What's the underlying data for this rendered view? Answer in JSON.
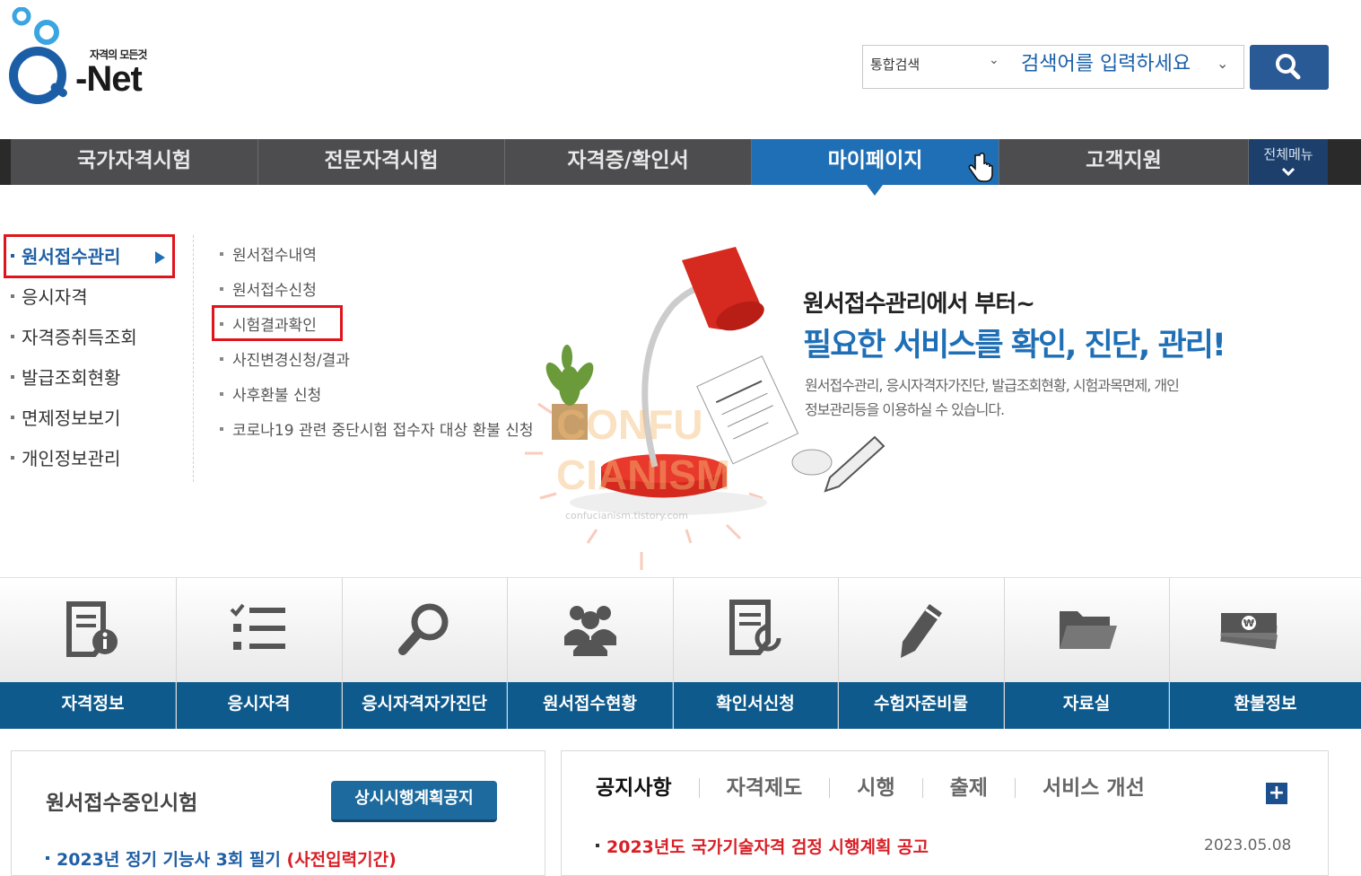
{
  "header": {
    "logo_tagline": "자격의 모든것",
    "logo_text": "-Net",
    "search_category": "통합검색",
    "search_placeholder": "검색어를 입력하세요"
  },
  "nav": {
    "items": [
      "국가자격시험",
      "전문자격시험",
      "자격증/확인서",
      "마이페이지",
      "고객지원"
    ],
    "active": "마이페이지",
    "all_menu_label": "전체메뉴"
  },
  "mypage_menu": {
    "left_items": [
      "원서접수관리",
      "응시자격",
      "자격증취득조회",
      "발급조회현황",
      "면제정보보기",
      "개인정보관리"
    ],
    "left_active": "원서접수관리",
    "sub_items": [
      "원서접수내역",
      "원서접수신청",
      "시험결과확인",
      "사진변경신청/결과",
      "사후환불 신청",
      "코로나19 관련 중단시험 접수자 대상 환불 신청"
    ],
    "sub_highlighted": "시험결과확인",
    "promo_line1": "원서접수관리에서 부터~",
    "promo_line2": "필요한 서비스를 확인, 진단, 관리!",
    "promo_desc": "원서접수관리, 응시자격자가진단, 발급조회현황, 시험과목면제, 개인정보관리등을 이용하실 수 있습니다.",
    "watermark_line1": "CONFU",
    "watermark_line2": "CIANISM",
    "watermark_url": "confucianism.tistory.com"
  },
  "quick_menu": [
    {
      "label": "자격정보",
      "icon": "document-info-icon"
    },
    {
      "label": "응시자격",
      "icon": "checklist-icon"
    },
    {
      "label": "응시자격자가진단",
      "icon": "magnifier-icon"
    },
    {
      "label": "원서접수현황",
      "icon": "people-icon"
    },
    {
      "label": "확인서신청",
      "icon": "document-return-icon"
    },
    {
      "label": "수험자준비물",
      "icon": "pencil-icon"
    },
    {
      "label": "자료실",
      "icon": "folder-icon"
    },
    {
      "label": "환불정보",
      "icon": "money-icon"
    }
  ],
  "exam_box": {
    "title": "원서접수중인시험",
    "button": "상시시행계획공지",
    "item_main": "2023년 정기 기능사 3회 필기",
    "item_note": "(사전입력기간)"
  },
  "notice_box": {
    "tabs": [
      "공지사항",
      "자격제도",
      "시행",
      "출제",
      "서비스 개선"
    ],
    "more_label": "+",
    "notice_title": "2023년도 국가기술자격 검정 시행계획 공고",
    "notice_date": "2023.05.08"
  },
  "colors": {
    "nav_bg": "#4d4d4f",
    "nav_active": "#1f6fb6",
    "quick_band": "#0e5a8c",
    "highlight_red": "#e0141c",
    "notice_red": "#d91f26"
  }
}
